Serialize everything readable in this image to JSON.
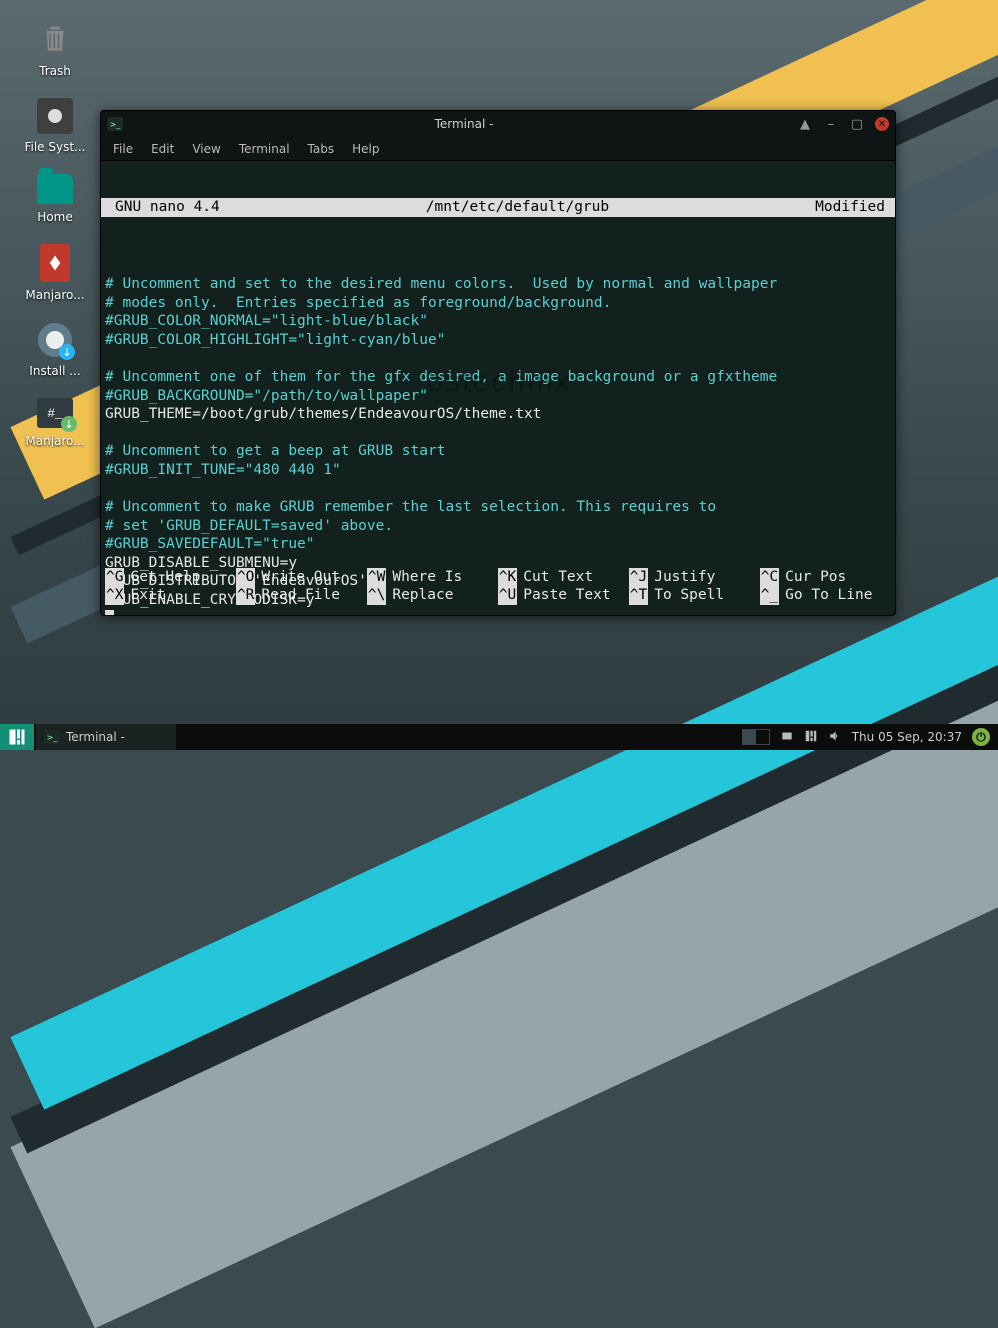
{
  "desktop": {
    "icons": [
      {
        "id": "trash",
        "label": "Trash"
      },
      {
        "id": "filesystem",
        "label": "File Syst..."
      },
      {
        "id": "home",
        "label": "Home"
      },
      {
        "id": "manjaro-pdf",
        "label": "Manjaro..."
      },
      {
        "id": "install",
        "label": "Install ..."
      },
      {
        "id": "manjaro-arch",
        "label": "Manjaro..."
      }
    ]
  },
  "terminal": {
    "title": "Terminal -",
    "menubar": [
      "File",
      "Edit",
      "View",
      "Terminal",
      "Tabs",
      "Help"
    ],
    "nano": {
      "version_label": "GNU nano 4.4",
      "file_path": "/mnt/etc/default/grub",
      "status": "Modified",
      "lines": [
        {
          "t": "",
          "c": false
        },
        {
          "t": "# Uncomment and set to the desired menu colors.  Used by normal and wallpaper",
          "c": true
        },
        {
          "t": "# modes only.  Entries specified as foreground/background.",
          "c": true
        },
        {
          "t": "#GRUB_COLOR_NORMAL=\"light-blue/black\"",
          "c": true
        },
        {
          "t": "#GRUB_COLOR_HIGHLIGHT=\"light-cyan/blue\"",
          "c": true
        },
        {
          "t": "",
          "c": false
        },
        {
          "t": "# Uncomment one of them for the gfx desired, a image background or a gfxtheme",
          "c": true
        },
        {
          "t": "#GRUB_BACKGROUND=\"/path/to/wallpaper\"",
          "c": true
        },
        {
          "t": "GRUB_THEME=/boot/grub/themes/EndeavourOS/theme.txt",
          "c": false
        },
        {
          "t": "",
          "c": false
        },
        {
          "t": "# Uncomment to get a beep at GRUB start",
          "c": true
        },
        {
          "t": "#GRUB_INIT_TUNE=\"480 440 1\"",
          "c": true
        },
        {
          "t": "",
          "c": false
        },
        {
          "t": "# Uncomment to make GRUB remember the last selection. This requires to",
          "c": true
        },
        {
          "t": "# set 'GRUB_DEFAULT=saved' above.",
          "c": true
        },
        {
          "t": "#GRUB_SAVEDEFAULT=\"true\"",
          "c": true
        },
        {
          "t": "GRUB_DISABLE_SUBMENU=y",
          "c": false
        },
        {
          "t": "GRUB_DISTRIBUTOR='EndeavourOS'",
          "c": false
        },
        {
          "t": "GRUB_ENABLE_CRYPTODISK=y",
          "c": false
        }
      ],
      "shortcuts": [
        [
          {
            "k": "^G",
            "l": "Get Help"
          },
          {
            "k": "^O",
            "l": "Write Out"
          },
          {
            "k": "^W",
            "l": "Where Is"
          },
          {
            "k": "^K",
            "l": "Cut Text"
          },
          {
            "k": "^J",
            "l": "Justify"
          },
          {
            "k": "^C",
            "l": "Cur Pos"
          }
        ],
        [
          {
            "k": "^X",
            "l": "Exit"
          },
          {
            "k": "^R",
            "l": "Read File"
          },
          {
            "k": "^\\",
            "l": "Replace"
          },
          {
            "k": "^U",
            "l": "Paste Text"
          },
          {
            "k": "^T",
            "l": "To Spell"
          },
          {
            "k": "^_",
            "l": "Go To Line"
          }
        ]
      ]
    }
  },
  "taskbar": {
    "app_label": "Terminal -",
    "clock": "Thu 05 Sep, 20:37"
  },
  "watermark": "ostechnix"
}
